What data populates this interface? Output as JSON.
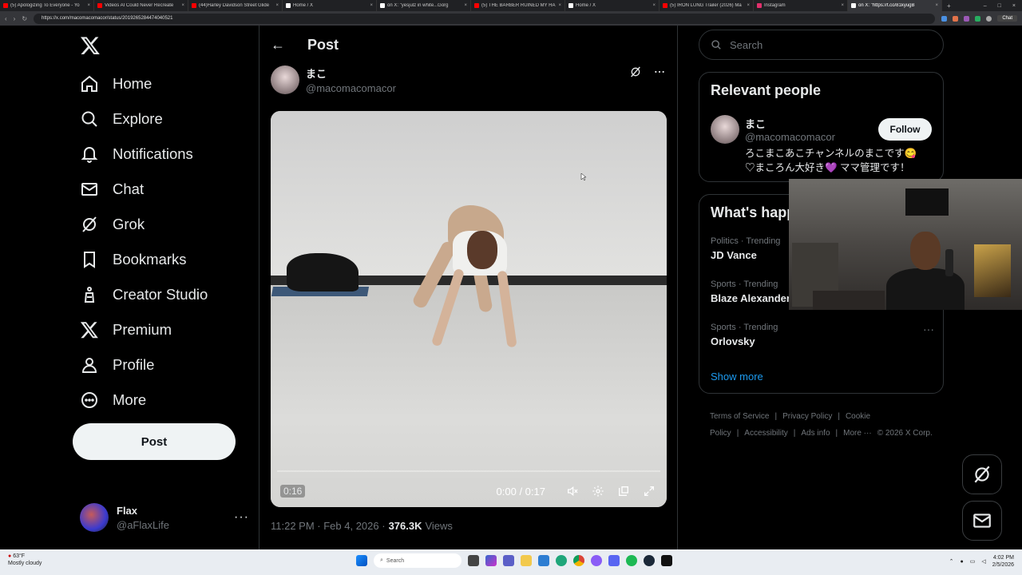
{
  "browser": {
    "tabs": [
      {
        "title": "(5) Apologizing To Everyone - Yo",
        "color": "#ff0000"
      },
      {
        "title": "Videos AI Could Never Recreate",
        "color": "#ff0000"
      },
      {
        "title": "(44)Harley Davidson Street Glide",
        "color": "#ff0000"
      },
      {
        "title": "Home / X",
        "color": "#ffffff"
      },
      {
        "title": "on X: \"yesjulz in white...Gorg",
        "color": "#ffffff"
      },
      {
        "title": "(5) THE BARBER RUINED MY HA",
        "color": "#ff0000"
      },
      {
        "title": "Home / X",
        "color": "#ffffff"
      },
      {
        "title": "(5) IRON LUNG Trailer (2026) Ma",
        "color": "#ff0000"
      },
      {
        "title": "Instagram",
        "color": "#e1306c"
      },
      {
        "title": "on X: \"https://t.co/81kyugB",
        "color": "#ffffff"
      }
    ],
    "url": "https://x.com/macomacomacor/status/2019265284474040521",
    "chat_label": "Chat"
  },
  "nav": {
    "items": [
      {
        "label": "Home"
      },
      {
        "label": "Explore"
      },
      {
        "label": "Notifications"
      },
      {
        "label": "Chat"
      },
      {
        "label": "Grok"
      },
      {
        "label": "Bookmarks"
      },
      {
        "label": "Creator Studio"
      },
      {
        "label": "Premium"
      },
      {
        "label": "Profile"
      },
      {
        "label": "More"
      }
    ],
    "post_button": "Post",
    "account": {
      "name": "Flax",
      "handle": "@aFlaxLife",
      "more": "···"
    }
  },
  "post": {
    "header_title": "Post",
    "author_name": "まこ",
    "author_handle": "@macomacomacor",
    "video": {
      "remaining": "0:16",
      "time": "0:00 / 0:17",
      "progress": 0.0
    },
    "meta_time": "11:22 PM · Feb 4, 2026 ·",
    "views_count": "376.3K",
    "views_label": "Views"
  },
  "search": {
    "placeholder": "Search"
  },
  "relevant": {
    "title": "Relevant people",
    "name": "まこ",
    "handle": "@macomacomacor",
    "follow_label": "Follow",
    "bio_line1": "ろこまこあこチャンネルのまこです😋",
    "bio_line2": "♡まころん大好き💜 ママ管理です！"
  },
  "happening": {
    "title": "What's happ",
    "trends": [
      {
        "context": "Politics · Trending",
        "name": "JD Vance"
      },
      {
        "context": "Sports · Trending",
        "name": "Blaze Alexander"
      },
      {
        "context": "Sports · Trending",
        "name": "Orlovsky"
      }
    ],
    "show_more": "Show more"
  },
  "footer": {
    "links": [
      "Terms of Service",
      "|",
      "Privacy Policy",
      "|",
      "Cookie Policy",
      "|",
      "Accessibility",
      "|",
      "Ads info",
      "|",
      "More ···",
      "© 2026 X Corp."
    ]
  },
  "taskbar": {
    "weather_temp": "63°F",
    "weather_desc": "Mostly cloudy",
    "search_label": "Search",
    "time": "4:02 PM",
    "date": "2/5/2026"
  },
  "colors": {
    "accent": "#1d9bf0",
    "background": "#000000",
    "border": "#2f3336",
    "muted": "#71767b"
  }
}
